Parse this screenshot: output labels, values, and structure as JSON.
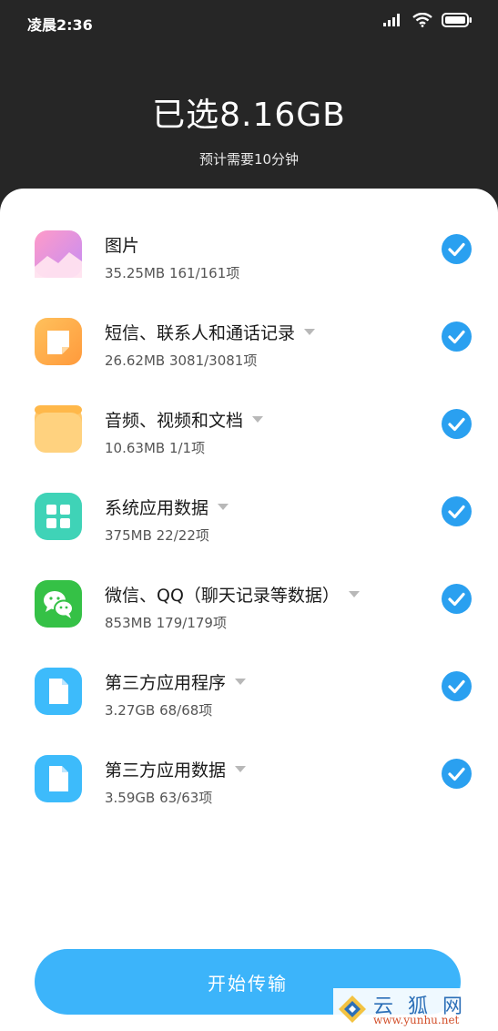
{
  "status_bar": {
    "time": "凌晨2:36",
    "icons": [
      "signal-icon",
      "wifi-icon",
      "battery-icon"
    ]
  },
  "header": {
    "title": "已选8.16GB",
    "subtitle": "预计需要10分钟"
  },
  "items": [
    {
      "title": "图片",
      "meta": "35.25MB  161/161项",
      "icon": "gallery-icon",
      "expandable": false,
      "checked": true
    },
    {
      "title": "短信、联系人和通话记录",
      "meta": "26.62MB  3081/3081项",
      "icon": "message-icon",
      "expandable": true,
      "checked": true
    },
    {
      "title": "音频、视频和文档",
      "meta": "10.63MB  1/1项",
      "icon": "folder-icon",
      "expandable": true,
      "checked": true
    },
    {
      "title": "系统应用数据",
      "meta": "375MB  22/22项",
      "icon": "apps-grid-icon",
      "expandable": true,
      "checked": true
    },
    {
      "title": "微信、QQ（聊天记录等数据）",
      "meta": "853MB  179/179项",
      "icon": "wechat-icon",
      "expandable": true,
      "checked": true
    },
    {
      "title": "第三方应用程序",
      "meta": "3.27GB  68/68项",
      "icon": "file-icon",
      "expandable": true,
      "checked": true
    },
    {
      "title": "第三方应用数据",
      "meta": "3.59GB  63/63项",
      "icon": "file-icon",
      "expandable": true,
      "checked": true
    }
  ],
  "start_button": {
    "label": "开始传输"
  },
  "watermark": {
    "text": "云狐网",
    "url": "www.yunhu.net"
  },
  "colors": {
    "accent": "#2aa0f0",
    "button": "#3cb4fa",
    "header_bg": "#262626"
  }
}
